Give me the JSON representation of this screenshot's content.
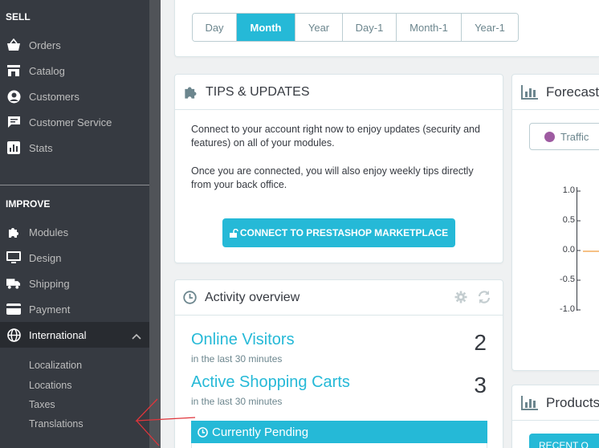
{
  "sidebar": {
    "sections": {
      "sell": "SELL",
      "improve": "IMPROVE"
    },
    "sell_items": [
      {
        "label": "Orders",
        "icon": "basket-icon"
      },
      {
        "label": "Catalog",
        "icon": "store-icon"
      },
      {
        "label": "Customers",
        "icon": "user-icon"
      },
      {
        "label": "Customer Service",
        "icon": "chat-icon"
      },
      {
        "label": "Stats",
        "icon": "stats-icon"
      }
    ],
    "improve_items": [
      {
        "label": "Modules",
        "icon": "puzzle-icon"
      },
      {
        "label": "Design",
        "icon": "monitor-icon"
      },
      {
        "label": "Shipping",
        "icon": "truck-icon"
      },
      {
        "label": "Payment",
        "icon": "card-icon"
      },
      {
        "label": "International",
        "icon": "globe-icon"
      }
    ],
    "international_sub": [
      "Localization",
      "Locations",
      "Taxes",
      "Translations"
    ]
  },
  "period": {
    "buttons": [
      "Day",
      "Month",
      "Year",
      "Day-1",
      "Month-1",
      "Year-1"
    ],
    "active": "Month"
  },
  "tips": {
    "title": "TIPS & UPDATES",
    "para1": "Connect to your account right now to enjoy updates (security and features) on all of your modules.",
    "para2": "Once you are connected, you will also enjoy weekly tips directly from your back office.",
    "button": "CONNECT TO PRESTASHOP MARKETPLACE"
  },
  "activity": {
    "title": "Activity overview",
    "online_label": "Online Visitors",
    "online_sub": "in the last 30 minutes",
    "online_value": "2",
    "carts_label": "Active Shopping Carts",
    "carts_sub": "in the last 30 minutes",
    "carts_value": "3",
    "pending": "Currently Pending"
  },
  "forecast": {
    "title": "Forecast",
    "traffic": "Traffic",
    "ticks": [
      "1.0",
      "0.5",
      "0.0",
      "-0.5",
      "-1.0"
    ]
  },
  "products": {
    "title": "Products",
    "recent": "RECENT O"
  },
  "colors": {
    "accent": "#25b9d7",
    "sidebar": "#363a41",
    "annotation": "#e0353b"
  }
}
